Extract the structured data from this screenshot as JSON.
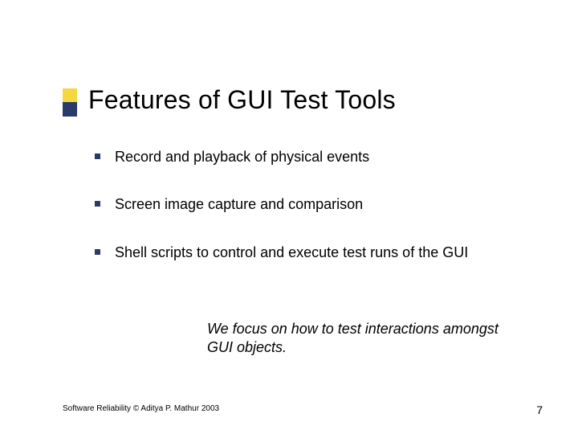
{
  "title": "Features of GUI Test Tools",
  "bullets": [
    "Record and playback of physical events",
    "Screen image capture and comparison",
    "Shell scripts to control and execute test runs of the GUI"
  ],
  "focus_note": "We focus on how to test interactions amongst GUI objects.",
  "footer": {
    "copyright": "Software Reliability © Aditya P. Mathur 2003",
    "page": "7"
  },
  "colors": {
    "accent_yellow": "#f5d742",
    "accent_navy": "#2a3a6a"
  }
}
